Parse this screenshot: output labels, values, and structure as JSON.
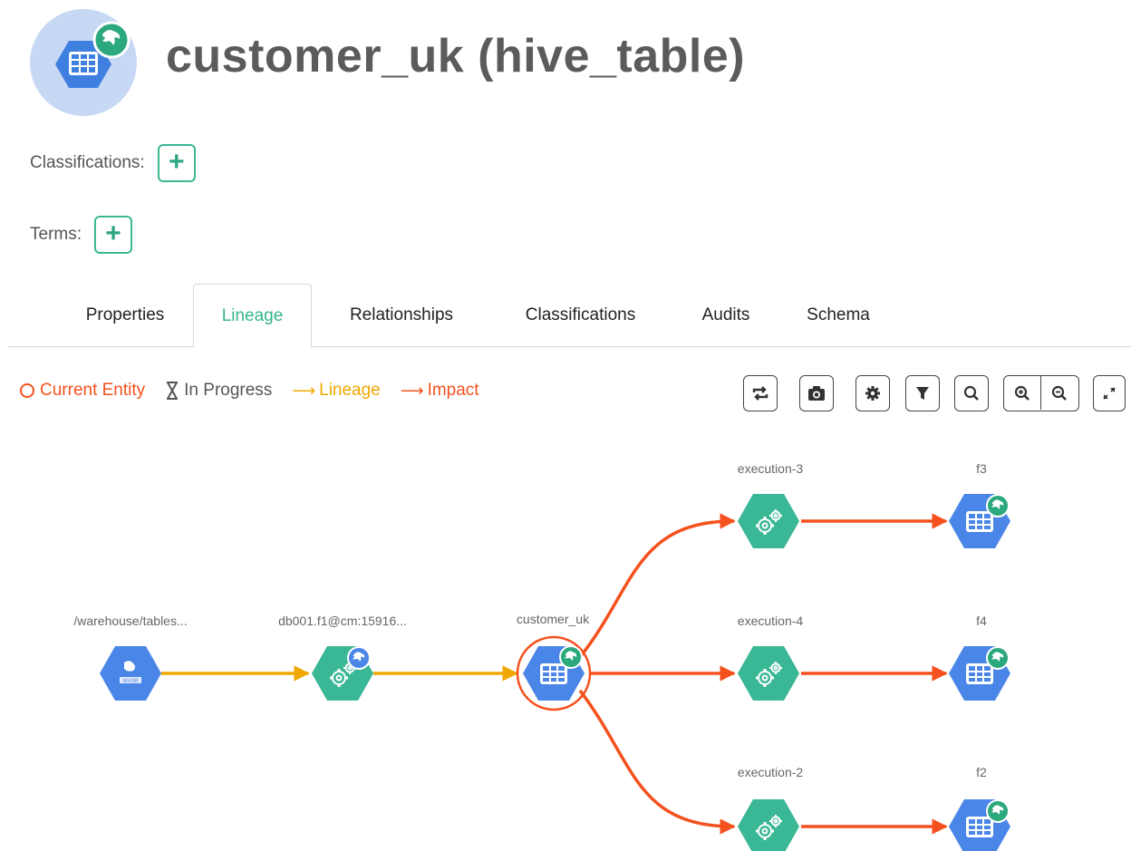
{
  "entity": {
    "title": "customer_uk (hive_table)",
    "icon": "hive-table-icon"
  },
  "classifications": {
    "label": "Classifications:",
    "add_label": "+"
  },
  "terms": {
    "label": "Terms:",
    "add_label": "+"
  },
  "tabs": [
    {
      "label": "Properties",
      "active": false
    },
    {
      "label": "Lineage",
      "active": true
    },
    {
      "label": "Relationships",
      "active": false
    },
    {
      "label": "Classifications",
      "active": false
    },
    {
      "label": "Audits",
      "active": false
    },
    {
      "label": "Schema",
      "active": false
    }
  ],
  "legend": {
    "current_entity": "Current Entity",
    "in_progress": "In Progress",
    "lineage": "Lineage",
    "impact": "Impact"
  },
  "colors": {
    "current": "#f4511e",
    "lineage": "#f0a800",
    "impact": "#f4511e",
    "in_progress": "#555555",
    "accent": "#37b58f",
    "process_node": "#3ab795",
    "dataset_node": "#4a86e8"
  },
  "toolbar": [
    "realign-icon",
    "camera-icon",
    "settings-icon",
    "filter-icon",
    "search-icon",
    "zoom-in-icon",
    "zoom-out-icon",
    "fullscreen-icon"
  ],
  "lineage": {
    "nodes": [
      {
        "id": "n1",
        "label": "/warehouse/tables...",
        "kind": "hdfs_path",
        "badge": false
      },
      {
        "id": "n2",
        "label": "db001.f1@cm:15916...",
        "kind": "process",
        "badge": true
      },
      {
        "id": "n3",
        "label": "customer_uk",
        "kind": "hive_table",
        "badge": true,
        "current": true
      },
      {
        "id": "n4",
        "label": "execution-3",
        "kind": "process",
        "badge": false
      },
      {
        "id": "n5",
        "label": "execution-4",
        "kind": "process",
        "badge": false
      },
      {
        "id": "n6",
        "label": "execution-2",
        "kind": "process",
        "badge": false
      },
      {
        "id": "n7",
        "label": "f3",
        "kind": "hive_table",
        "badge": true
      },
      {
        "id": "n8",
        "label": "f4",
        "kind": "hive_table",
        "badge": true
      },
      {
        "id": "n9",
        "label": "f2",
        "kind": "hive_table",
        "badge": true
      }
    ],
    "edges": [
      {
        "from": "n1",
        "to": "n2",
        "type": "lineage"
      },
      {
        "from": "n2",
        "to": "n3",
        "type": "lineage"
      },
      {
        "from": "n3",
        "to": "n4",
        "type": "impact"
      },
      {
        "from": "n3",
        "to": "n5",
        "type": "impact"
      },
      {
        "from": "n3",
        "to": "n6",
        "type": "impact"
      },
      {
        "from": "n4",
        "to": "n7",
        "type": "impact"
      },
      {
        "from": "n5",
        "to": "n8",
        "type": "impact"
      },
      {
        "from": "n6",
        "to": "n9",
        "type": "impact"
      }
    ]
  }
}
